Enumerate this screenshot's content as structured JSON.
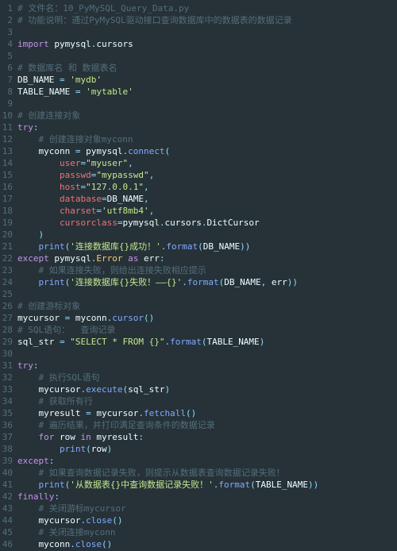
{
  "lines": {
    "1": [
      [
        "cm",
        "# 文件名：10_PyMySQL_Query_Data.py"
      ]
    ],
    "2": [
      [
        "cm",
        "# 功能说明：通过PyMySQL驱动接口查询数据库中的数据表的数据记录"
      ]
    ],
    "3": [
      [
        "",
        ""
      ]
    ],
    "4": [
      [
        "kw",
        "import"
      ],
      [
        "",
        " "
      ],
      [
        "var",
        "pymysql"
      ],
      [
        "op",
        "."
      ],
      [
        "var",
        "cursors"
      ]
    ],
    "5": [
      [
        "",
        ""
      ]
    ],
    "6": [
      [
        "cm",
        "# 数据库名 和 数据表名"
      ]
    ],
    "7": [
      [
        "var",
        "DB_NAME"
      ],
      [
        "",
        " "
      ],
      [
        "op",
        "="
      ],
      [
        "",
        " "
      ],
      [
        "str",
        "'mydb'"
      ]
    ],
    "8": [
      [
        "var",
        "TABLE_NAME"
      ],
      [
        "",
        " "
      ],
      [
        "op",
        "="
      ],
      [
        "",
        " "
      ],
      [
        "str",
        "'mytable'"
      ]
    ],
    "9": [
      [
        "",
        ""
      ]
    ],
    "10": [
      [
        "cm",
        "# 创建连接对象"
      ]
    ],
    "11": [
      [
        "kw",
        "try"
      ],
      [
        "op",
        ":"
      ]
    ],
    "12": [
      [
        "",
        "    "
      ],
      [
        "cm",
        "# 创建连接对象myconn"
      ]
    ],
    "13": [
      [
        "",
        "    "
      ],
      [
        "var",
        "myconn"
      ],
      [
        "",
        " "
      ],
      [
        "op",
        "="
      ],
      [
        "",
        " "
      ],
      [
        "var",
        "pymysql"
      ],
      [
        "op",
        "."
      ],
      [
        "fn",
        "connect"
      ],
      [
        "op",
        "("
      ]
    ],
    "14": [
      [
        "",
        "        "
      ],
      [
        "prm",
        "user"
      ],
      [
        "op",
        "="
      ],
      [
        "str",
        "\"myuser\""
      ],
      [
        "op",
        ","
      ]
    ],
    "15": [
      [
        "",
        "        "
      ],
      [
        "prm",
        "passwd"
      ],
      [
        "op",
        "="
      ],
      [
        "str",
        "\"mypasswd\""
      ],
      [
        "op",
        ","
      ]
    ],
    "16": [
      [
        "",
        "        "
      ],
      [
        "prm",
        "host"
      ],
      [
        "op",
        "="
      ],
      [
        "str",
        "\"127.0.0.1\""
      ],
      [
        "op",
        ","
      ]
    ],
    "17": [
      [
        "",
        "        "
      ],
      [
        "prm",
        "database"
      ],
      [
        "op",
        "="
      ],
      [
        "var",
        "DB_NAME"
      ],
      [
        "op",
        ","
      ]
    ],
    "18": [
      [
        "",
        "        "
      ],
      [
        "prm",
        "charset"
      ],
      [
        "op",
        "="
      ],
      [
        "str",
        "'utf8mb4'"
      ],
      [
        "op",
        ","
      ]
    ],
    "19": [
      [
        "",
        "        "
      ],
      [
        "prm",
        "cursorclass"
      ],
      [
        "op",
        "="
      ],
      [
        "var",
        "pymysql"
      ],
      [
        "op",
        "."
      ],
      [
        "var",
        "cursors"
      ],
      [
        "op",
        "."
      ],
      [
        "var",
        "DictCursor"
      ]
    ],
    "20": [
      [
        "",
        "    "
      ],
      [
        "op",
        ")"
      ]
    ],
    "21": [
      [
        "",
        "    "
      ],
      [
        "fn",
        "print"
      ],
      [
        "op",
        "("
      ],
      [
        "str",
        "'连接数据库{}成功！'"
      ],
      [
        "op",
        "."
      ],
      [
        "fn",
        "format"
      ],
      [
        "op",
        "("
      ],
      [
        "var",
        "DB_NAME"
      ],
      [
        "op",
        "))"
      ]
    ],
    "22": [
      [
        "kw",
        "except"
      ],
      [
        "",
        " "
      ],
      [
        "var",
        "pymysql"
      ],
      [
        "op",
        "."
      ],
      [
        "cls",
        "Error"
      ],
      [
        "",
        " "
      ],
      [
        "kw",
        "as"
      ],
      [
        "",
        " "
      ],
      [
        "var",
        "err"
      ],
      [
        "op",
        ":"
      ]
    ],
    "23": [
      [
        "",
        "    "
      ],
      [
        "cm",
        "# 如果连接失败，则给出连接失败相应提示"
      ]
    ],
    "24": [
      [
        "",
        "    "
      ],
      [
        "fn",
        "print"
      ],
      [
        "op",
        "("
      ],
      [
        "str",
        "'连接数据库{}失败！——{}'"
      ],
      [
        "op",
        "."
      ],
      [
        "fn",
        "format"
      ],
      [
        "op",
        "("
      ],
      [
        "var",
        "DB_NAME"
      ],
      [
        "op",
        ", "
      ],
      [
        "var",
        "err"
      ],
      [
        "op",
        "))"
      ]
    ],
    "25": [
      [
        "",
        ""
      ]
    ],
    "26": [
      [
        "cm",
        "# 创建游标对象"
      ]
    ],
    "27": [
      [
        "var",
        "mycursor"
      ],
      [
        "",
        " "
      ],
      [
        "op",
        "="
      ],
      [
        "",
        " "
      ],
      [
        "var",
        "myconn"
      ],
      [
        "op",
        "."
      ],
      [
        "fn",
        "cursor"
      ],
      [
        "op",
        "()"
      ]
    ],
    "28": [
      [
        "cm",
        "# SQL语句：  查询记录"
      ]
    ],
    "29": [
      [
        "var",
        "sql_str"
      ],
      [
        "",
        " "
      ],
      [
        "op",
        "="
      ],
      [
        "",
        " "
      ],
      [
        "str",
        "\"SELECT * FROM {}\""
      ],
      [
        "op",
        "."
      ],
      [
        "fn",
        "format"
      ],
      [
        "op",
        "("
      ],
      [
        "var",
        "TABLE_NAME"
      ],
      [
        "op",
        ")"
      ]
    ],
    "30": [
      [
        "",
        ""
      ]
    ],
    "31": [
      [
        "kw",
        "try"
      ],
      [
        "op",
        ":"
      ]
    ],
    "32": [
      [
        "",
        "    "
      ],
      [
        "cm",
        "# 执行SQL语句"
      ]
    ],
    "33": [
      [
        "",
        "    "
      ],
      [
        "var",
        "mycursor"
      ],
      [
        "op",
        "."
      ],
      [
        "fn",
        "execute"
      ],
      [
        "op",
        "("
      ],
      [
        "var",
        "sql_str"
      ],
      [
        "op",
        ")"
      ]
    ],
    "34": [
      [
        "",
        "    "
      ],
      [
        "cm",
        "# 获取所有行"
      ]
    ],
    "35": [
      [
        "",
        "    "
      ],
      [
        "var",
        "myresult"
      ],
      [
        "",
        " "
      ],
      [
        "op",
        "="
      ],
      [
        "",
        " "
      ],
      [
        "var",
        "mycursor"
      ],
      [
        "op",
        "."
      ],
      [
        "fn",
        "fetchall"
      ],
      [
        "op",
        "()"
      ]
    ],
    "36": [
      [
        "",
        "    "
      ],
      [
        "cm",
        "# 遍历结果，并打印满足查询条件的数据记录"
      ]
    ],
    "37": [
      [
        "",
        "    "
      ],
      [
        "kw",
        "for"
      ],
      [
        "",
        " "
      ],
      [
        "var",
        "row"
      ],
      [
        "",
        " "
      ],
      [
        "kw",
        "in"
      ],
      [
        "",
        " "
      ],
      [
        "var",
        "myresult"
      ],
      [
        "op",
        ":"
      ]
    ],
    "38": [
      [
        "",
        "        "
      ],
      [
        "fn",
        "print"
      ],
      [
        "op",
        "("
      ],
      [
        "var",
        "row"
      ],
      [
        "op",
        ")"
      ]
    ],
    "39": [
      [
        "kw",
        "except"
      ],
      [
        "op",
        ":"
      ]
    ],
    "40": [
      [
        "",
        "    "
      ],
      [
        "cm",
        "# 如果查询数据记录失败，则提示从数据表查询数据记录失败！"
      ]
    ],
    "41": [
      [
        "",
        "    "
      ],
      [
        "fn",
        "print"
      ],
      [
        "op",
        "("
      ],
      [
        "str",
        "'从数据表{}中查询数据记录失败！'"
      ],
      [
        "op",
        "."
      ],
      [
        "fn",
        "format"
      ],
      [
        "op",
        "("
      ],
      [
        "var",
        "TABLE_NAME"
      ],
      [
        "op",
        "))"
      ]
    ],
    "42": [
      [
        "kw",
        "finally"
      ],
      [
        "op",
        ":"
      ]
    ],
    "43": [
      [
        "",
        "    "
      ],
      [
        "cm",
        "# 关闭游标mycursor"
      ]
    ],
    "44": [
      [
        "",
        "    "
      ],
      [
        "var",
        "mycursor"
      ],
      [
        "op",
        "."
      ],
      [
        "fn",
        "close"
      ],
      [
        "op",
        "()"
      ]
    ],
    "45": [
      [
        "",
        "    "
      ],
      [
        "cm",
        "# 关闭连接myconn"
      ]
    ],
    "46": [
      [
        "",
        "    "
      ],
      [
        "var",
        "myconn"
      ],
      [
        "op",
        "."
      ],
      [
        "fn",
        "close"
      ],
      [
        "op",
        "()"
      ]
    ]
  },
  "total_lines": 46
}
